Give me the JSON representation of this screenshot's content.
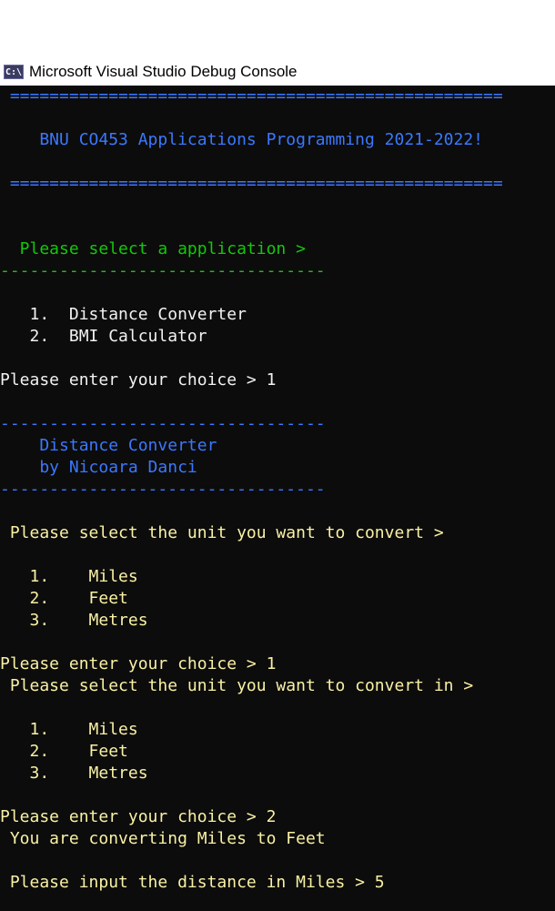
{
  "window": {
    "icon_text": "C:\\",
    "title": "Microsoft Visual Studio Debug Console"
  },
  "console": {
    "lines": [
      {
        "text": " ==================================================",
        "color": "blue"
      },
      {
        "text": "    BNU CO453 Applications Programming 2021-2022!",
        "color": "blue"
      },
      {
        "text": " ==================================================",
        "color": "blue"
      },
      {
        "text": "  Please select a application >",
        "color": "green"
      },
      {
        "text": "---------------------------------",
        "color": "green"
      },
      {
        "text": "   1.  Distance Converter",
        "color": "white"
      },
      {
        "text": "   2.  BMI Calculator",
        "color": "white"
      },
      {
        "text": "Please enter your choice > 1",
        "color": "white"
      },
      {
        "text": "---------------------------------",
        "color": "blue"
      },
      {
        "text": "    Distance Converter",
        "color": "blue"
      },
      {
        "text": "    by Nicoara Danci",
        "color": "blue"
      },
      {
        "text": "---------------------------------",
        "color": "blue"
      },
      {
        "text": " Please select the unit you want to convert >",
        "color": "yellow"
      },
      {
        "text": "   1.    Miles",
        "color": "yellow"
      },
      {
        "text": "   2.    Feet",
        "color": "yellow"
      },
      {
        "text": "   3.    Metres",
        "color": "yellow"
      },
      {
        "text": "Please enter your choice > 1",
        "color": "yellow"
      },
      {
        "text": " Please select the unit you want to convert in >",
        "color": "yellow"
      },
      {
        "text": "   1.    Miles",
        "color": "yellow"
      },
      {
        "text": "   2.    Feet",
        "color": "yellow"
      },
      {
        "text": "   3.    Metres",
        "color": "yellow"
      },
      {
        "text": "Please enter your choice > 2",
        "color": "yellow"
      },
      {
        "text": " You are converting Miles to Feet",
        "color": "yellow"
      },
      {
        "text": " Please input the distance in Miles > 5",
        "color": "yellow"
      }
    ]
  }
}
